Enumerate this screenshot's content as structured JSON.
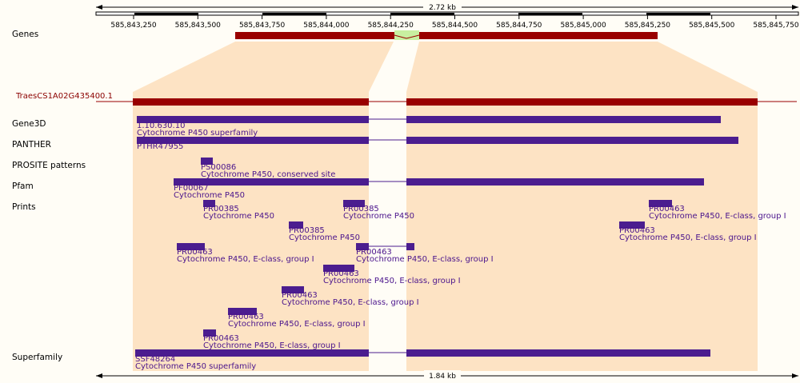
{
  "top_scale": {
    "label": "2.72 kb"
  },
  "bottom_scale": {
    "label": "1.84 kb"
  },
  "ticks": [
    "585,843,250",
    "585,843,500",
    "585,843,750",
    "585,844,000",
    "585,844,250",
    "585,844,500",
    "585,844,750",
    "585,845,000",
    "585,845,250",
    "585,845,500",
    "585,845,750"
  ],
  "tracks": {
    "genes": "Genes",
    "gene3d": "Gene3D",
    "panther": "PANTHER",
    "prosite": "PROSITE patterns",
    "pfam": "Pfam",
    "prints": "Prints",
    "superfamily": "Superfamily"
  },
  "transcript": {
    "name": "TraesCS1A02G435400.1"
  },
  "features": [
    {
      "id": "1.10.630.10",
      "desc": "Cytochrome P450 superfamily"
    },
    {
      "id": "PTHR47955",
      "desc": ""
    },
    {
      "id": "PS00086",
      "desc": "Cytochrome P450, conserved site"
    },
    {
      "id": "PF00067",
      "desc": "Cytochrome P450"
    },
    {
      "id": "PR00385",
      "desc": "Cytochrome P450"
    },
    {
      "id": "PR00385",
      "desc": "Cytochrome P450"
    },
    {
      "id": "PR00463",
      "desc": "Cytochrome P450, E-class, group I"
    },
    {
      "id": "PR00385",
      "desc": "Cytochrome P450"
    },
    {
      "id": "PR00463",
      "desc": "Cytochrome P450, E-class, group I"
    },
    {
      "id": "PR00463",
      "desc": "Cytochrome P450, E-class, group I"
    },
    {
      "id": "PR00463",
      "desc": "Cytochrome P450, E-class, group I"
    },
    {
      "id": "PR00463",
      "desc": "Cytochrome P450, E-class, group I"
    },
    {
      "id": "PR00463",
      "desc": "Cytochrome P450, E-class, group I"
    },
    {
      "id": "PR00463",
      "desc": "Cytochrome P450, E-class, group I"
    },
    {
      "id": "PR00463",
      "desc": "Cytochrome P450, E-class, group I"
    },
    {
      "id": "SSF48264",
      "desc": "Cytochrome P450 superfamily"
    }
  ],
  "colors": {
    "exon": "#990000",
    "domain": "#4b1d8f",
    "intron_highlight": "#c8f0a0",
    "zoom_fill": "#fde3c4",
    "background": "#fffdf6"
  }
}
